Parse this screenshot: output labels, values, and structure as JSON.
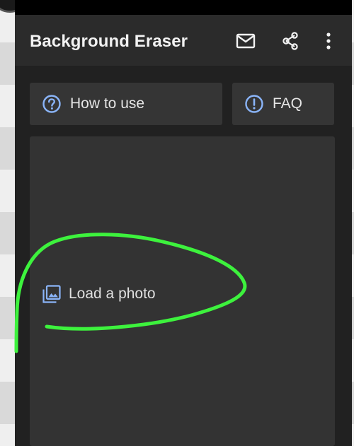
{
  "app": {
    "title": "Background Eraser"
  },
  "appbar": {
    "actions": [
      {
        "name": "mail",
        "icon": "mail-icon"
      },
      {
        "name": "share",
        "icon": "share-icon"
      },
      {
        "name": "more",
        "icon": "more-vert-icon"
      }
    ]
  },
  "buttons": {
    "how_to_use": {
      "label": "How to use",
      "icon": "help-circle-icon"
    },
    "faq": {
      "label": "FAQ",
      "icon": "info-circle-icon"
    }
  },
  "panel": {
    "load_photo": {
      "label": "Load a photo",
      "icon": "photo-library-icon"
    }
  },
  "colors": {
    "accent_icon": "#8ab4f8",
    "annotation": "#3df23d",
    "surface": "#212121",
    "appbar": "#2b2b2b",
    "card": "#353535"
  }
}
